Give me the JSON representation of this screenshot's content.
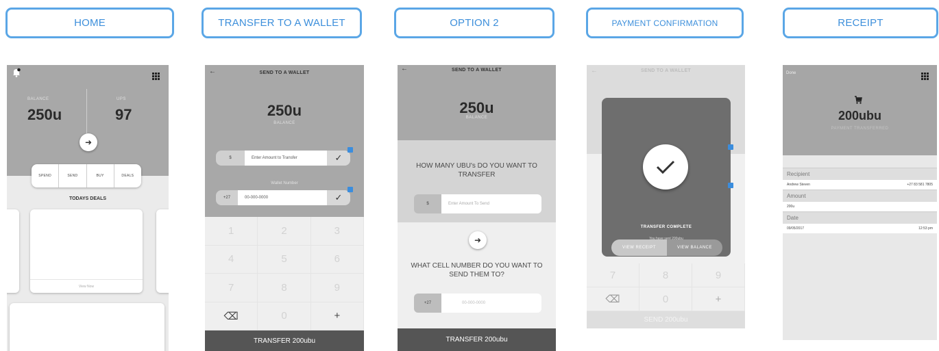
{
  "labels": {
    "home": "HOME",
    "transfer": "TRANSFER TO A WALLET",
    "option2": "OPTION 2",
    "confirmation": "PAYMENT CONFIRMATION",
    "receipt": "RECEIPT"
  },
  "home": {
    "balance_label": "BALANCE",
    "balance_value": "250u",
    "ups_label": "UPS",
    "ups_value": "97",
    "tabs": [
      "SPEND",
      "SEND",
      "BUY",
      "DEALS"
    ],
    "deals_title": "TODAYS DEALS",
    "view_now": "View Now"
  },
  "transfer": {
    "title": "SEND TO A WALLET",
    "balance_value": "250u",
    "balance_label": "BALANCE",
    "amount_prefix": "$",
    "amount_placeholder": "Enter Amount to Transfer",
    "wallet_label": "Wallet Number",
    "phone_prefix": "+27",
    "phone_value": "00-000-0000",
    "keys": [
      "1",
      "2",
      "3",
      "4",
      "5",
      "6",
      "7",
      "8",
      "9",
      "⌫",
      "0",
      "+"
    ],
    "button": "TRANSFER 200ubu"
  },
  "option2": {
    "title": "SEND TO A WALLET",
    "balance_value": "250u",
    "balance_label": "BALANCE",
    "question1": "HOW MANY UBU's DO YOU WANT TO TRANSFER",
    "amount_prefix": "$",
    "amount_placeholder": "Enter Amount To Send",
    "question2": "WHAT CELL NUMBER DO YOU WANT TO SEND THEM TO?",
    "phone_prefix": "+27",
    "phone_value": "00-000-0000",
    "button": "TRANSFER 200ubu"
  },
  "confirmation": {
    "title": "SEND TO A WALLET",
    "status": "TRANSFER COMPLETE",
    "subtext": "You have sent 200ubu",
    "view_receipt": "VIEW RECEIPT",
    "view_balance": "VIEW BALANCE",
    "keys": [
      "7",
      "8",
      "9",
      "⌫",
      "0",
      "+"
    ],
    "button": "SEND 200ubu"
  },
  "receipt": {
    "done": "Done",
    "amount_value": "200ubu",
    "caption": "PAYMENT TRANSFERRED",
    "recipient_head": "Recipient",
    "recipient_name": "Andrew Steven",
    "recipient_phone": "+27 83 581 7805",
    "amount_head": "Amount",
    "amount_row": "200u",
    "date_head": "Date",
    "date_value": "09/05/2017",
    "time_value": "12:53 pm"
  },
  "colors": {
    "accent": "#3d8fdb",
    "header_gray": "#a8a8a8",
    "bar_dark": "#555555"
  }
}
